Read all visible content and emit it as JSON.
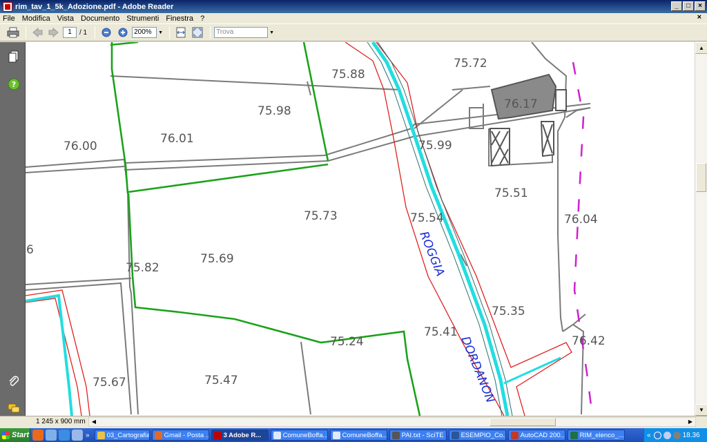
{
  "window": {
    "title": "rim_tav_1_5k_Adozione.pdf - Adobe Reader",
    "buttons": {
      "minimize": "_",
      "maximize": "□",
      "close": "×"
    }
  },
  "menu": {
    "items": [
      "File",
      "Modifica",
      "Vista",
      "Documento",
      "Strumenti",
      "Finestra",
      "?"
    ],
    "close_doc": "×"
  },
  "toolbar": {
    "page_current": "1",
    "page_total": "/ 1",
    "zoom": "200%",
    "find_placeholder": "Trova"
  },
  "map": {
    "elevations": [
      "75.72",
      "75.88",
      "75.98",
      "76.17",
      "76.00",
      "76.01",
      "75.99",
      "75.51",
      "75.73",
      "75.54",
      "76.04",
      "6",
      "75.82",
      "75.69",
      "75.35",
      "75.41",
      "76.42",
      "75.24",
      "75.67",
      "75.47"
    ],
    "river_labels": [
      "ROGGIA",
      "DORDANON"
    ]
  },
  "status": {
    "page_size": "1 245 x 900 mm"
  },
  "taskbar": {
    "start": "Start",
    "tasks": [
      {
        "label": "03_Cartografia",
        "color": "#e8c34a"
      },
      {
        "label": "Gmail - Posta ...",
        "color": "#e06a2a"
      },
      {
        "label": "3 Adobe R...",
        "color": "#c00000",
        "active": true
      },
      {
        "label": "ComuneBoffa...",
        "color": "#dfe8ff"
      },
      {
        "label": "ComuneBoffa...",
        "color": "#dfe8ff"
      },
      {
        "label": "PAI.txt - SciTE",
        "color": "#555555"
      },
      {
        "label": "ESEMPIO_Co...",
        "color": "#2b579a"
      },
      {
        "label": "AutoCAD 200...",
        "color": "#c0392b"
      },
      {
        "label": "RIM_elenco_...",
        "color": "#1e7145"
      }
    ],
    "clock": "18.36"
  }
}
